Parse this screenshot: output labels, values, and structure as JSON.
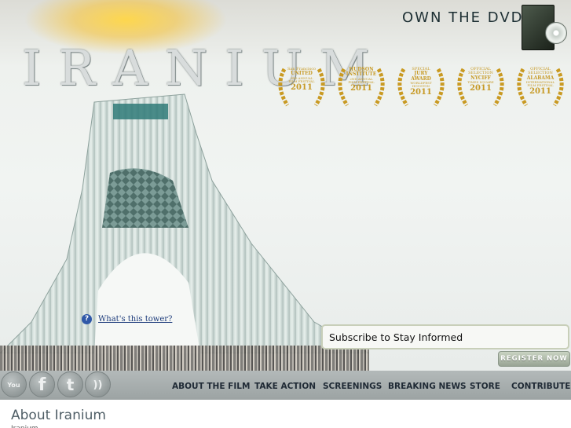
{
  "header": {
    "logo_text": "IRANIUM",
    "dvd_label": "OWN THE DVD"
  },
  "awards": [
    {
      "line1": "San Francisco",
      "line2": "UNITED",
      "line3": "3RD ANNUAL FILM FESTIVAL",
      "year": "2011"
    },
    {
      "line1": "",
      "line2": "HUDSON INSTITUTE",
      "line3": "2ND ANNUAL FILM FESTIVAL",
      "year": "2011"
    },
    {
      "line1": "SPECIAL",
      "line2": "JURY AWARD",
      "line3": "WORLDFEST HOUSTON",
      "year": "2011"
    },
    {
      "line1": "OFFICIAL SELECTION",
      "line2": "NYCIFF",
      "line3": "TIMES SQUARE",
      "year": "2011"
    },
    {
      "line1": "OFFICIAL SELECTION",
      "line2": "ALABAMA",
      "line3": "INTERNATIONAL FILM FESTIVAL",
      "year": "2011"
    }
  ],
  "tower_link": {
    "icon": "help-icon",
    "text": "What's this tower?"
  },
  "subscribe": {
    "label": "Subscribe to Stay Informed"
  },
  "register_button": "REGISTER NOW",
  "social": [
    {
      "name": "youtube",
      "glyph": "You"
    },
    {
      "name": "facebook",
      "glyph": "f"
    },
    {
      "name": "twitter",
      "glyph": "t"
    },
    {
      "name": "rss",
      "glyph": "))"
    }
  ],
  "nav": [
    "ABOUT THE FILM",
    "TAKE ACTION",
    "SCREENINGS",
    "BREAKING NEWS",
    "STORE",
    "CONTRIBUTE"
  ],
  "about": {
    "title": "About Iranium",
    "text": "Iranium"
  },
  "colors": {
    "nav_text": "#1f2a35",
    "award_gold": "#c79a26",
    "link_blue": "#1b3a7a"
  }
}
